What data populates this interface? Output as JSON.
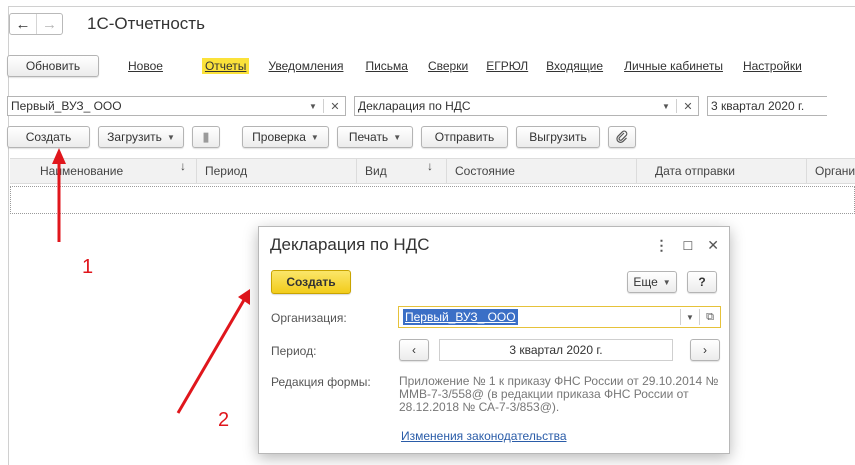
{
  "window": {
    "title": "1С-Отчетность"
  },
  "nav": {
    "back_icon": "←",
    "forward_icon": "→"
  },
  "tabs": {
    "refresh": "Обновить",
    "items": [
      "Новое",
      "Отчеты",
      "Уведомления",
      "Письма",
      "Сверки",
      "ЕГРЮЛ",
      "Входящие",
      "Личные кабинеты",
      "Настройки"
    ],
    "active": "Отчеты",
    "active_color": "#fbe23a"
  },
  "filters": {
    "organization": "Первый_ВУЗ_ ООО",
    "report": "Декларация по НДС",
    "period": "3 квартал 2020 г."
  },
  "toolbar": {
    "create": "Создать",
    "load": "Загрузить",
    "check": "Проверка",
    "print": "Печать",
    "send": "Отправить",
    "export": "Выгрузить"
  },
  "table": {
    "columns": [
      "Наименование",
      "Период",
      "Вид",
      "Состояние",
      "Дата отправки",
      "Органи"
    ],
    "sort_arrow": "↓"
  },
  "annotations": {
    "label1": "1",
    "label2": "2",
    "arrow_color": "#e0161c"
  },
  "dialog": {
    "title": "Декларация по НДС",
    "create": "Создать",
    "more": "Еще",
    "help": "?",
    "org_label": "Организация:",
    "org_value": "Первый_ВУЗ_ ООО",
    "period_label": "Период:",
    "period_value": "3 квартал 2020 г.",
    "prev": "‹",
    "next": "›",
    "redaction_label": "Редакция формы:",
    "redaction_value": "Приложение № 1 к приказу ФНС России от 29.10.2014 № ММВ-7-3/558@ (в редакции приказа ФНС России от 28.12.2018 № СА-7-3/853@).",
    "law_link": "Изменения законодательства",
    "primary_color": "#f2cc1b"
  }
}
